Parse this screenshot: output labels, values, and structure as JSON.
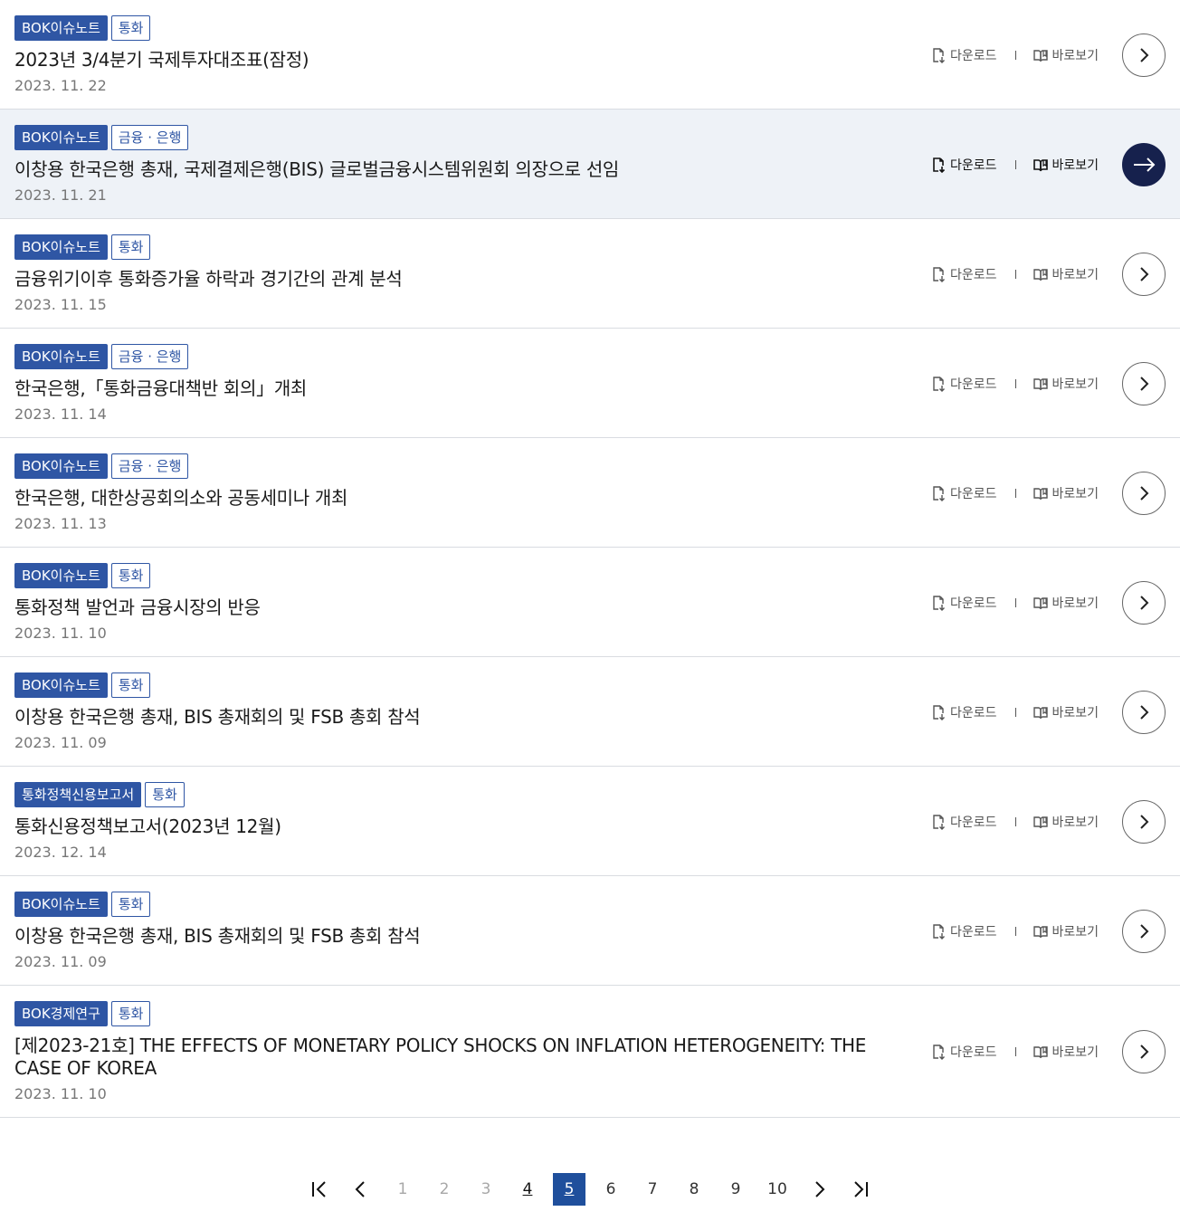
{
  "actions": {
    "download_label": "다운로드",
    "view_label": "바로보기"
  },
  "items": [
    {
      "type": "BOK이슈노트",
      "topic": "통화",
      "title": "2023년 3/4분기 국제투자대조표(잠정)",
      "date": "2023. 11. 22"
    },
    {
      "type": "BOK이슈노트",
      "topic": "금융 · 은행",
      "title": "이창용 한국은행 총재, 국제결제은행(BIS) 글로벌금융시스템위원회 의장으로 선임",
      "date": "2023. 11. 21"
    },
    {
      "type": "BOK이슈노트",
      "topic": "통화",
      "title": "금융위기이후 통화증가율 하락과 경기간의 관계 분석",
      "date": "2023. 11. 15"
    },
    {
      "type": "BOK이슈노트",
      "topic": "금융 · 은행",
      "title": "한국은행,「통화금융대책반 회의」개최",
      "date": "2023. 11. 14"
    },
    {
      "type": "BOK이슈노트",
      "topic": "금융 · 은행",
      "title": "한국은행, 대한상공회의소와 공동세미나 개최",
      "date": "2023. 11. 13"
    },
    {
      "type": "BOK이슈노트",
      "topic": "통화",
      "title": "통화정책 발언과 금융시장의 반응",
      "date": "2023. 11. 10"
    },
    {
      "type": "BOK이슈노트",
      "topic": "통화",
      "title": "이창용 한국은행 총재, BIS 총재회의 및 FSB 총회 참석",
      "date": "2023. 11. 09"
    },
    {
      "type": "통화정책신용보고서",
      "topic": "통화",
      "title": "통화신용정책보고서(2023년 12월)",
      "date": "2023. 12. 14"
    },
    {
      "type": "BOK이슈노트",
      "topic": "통화",
      "title": "이창용 한국은행 총재, BIS 총재회의 및 FSB 총회 참석",
      "date": "2023. 11. 09"
    },
    {
      "type": "BOK경제연구",
      "topic": "통화",
      "title": "[제2023-21호] THE EFFECTS OF MONETARY POLICY SHOCKS ON INFLATION HETEROGENEITY: THE CASE OF KOREA",
      "date": "2023. 11. 10"
    }
  ],
  "pagination": {
    "pages": [
      "1",
      "2",
      "3",
      "4",
      "5",
      "6",
      "7",
      "8",
      "9",
      "10"
    ],
    "current": "5"
  },
  "colors": {
    "type_badge": "#2f56a4",
    "highlight_row": "#eef2f7",
    "active_button": "#16214d",
    "current_page": "#1f4f9c"
  }
}
